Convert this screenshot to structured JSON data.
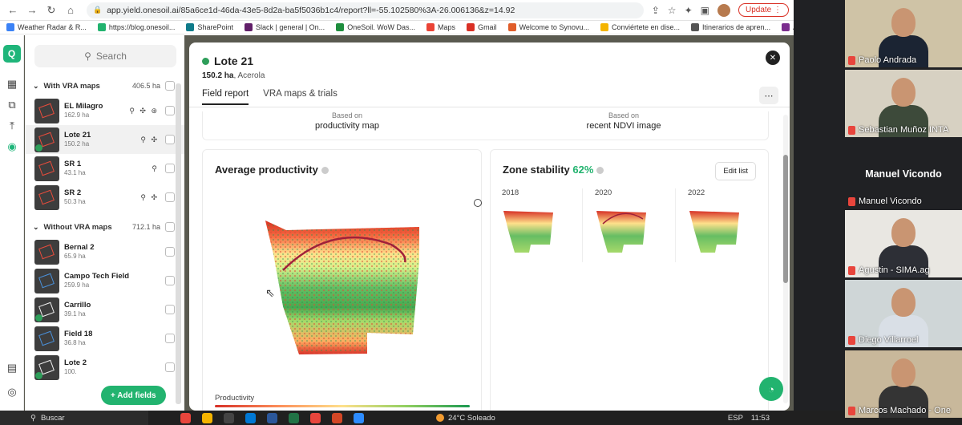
{
  "browser": {
    "url": "app.yield.onesoil.ai/85a6ce1d-46da-43e5-8d2a-ba5f5036b1c4/report?ll=-55.102580%3A-26.006136&z=14.92",
    "update_label": "Update",
    "bookmarks": [
      {
        "label": "Weather Radar & R...",
        "color": "#3b82f6"
      },
      {
        "label": "https://blog.onesoil...",
        "color": "#22b36f"
      },
      {
        "label": "SharePoint",
        "color": "#0f7b8a"
      },
      {
        "label": "Slack | general | On...",
        "color": "#611f69"
      },
      {
        "label": "OneSoil. WoW Das...",
        "color": "#1e8e3e"
      },
      {
        "label": "Maps",
        "color": "#ea4335"
      },
      {
        "label": "Gmail",
        "color": "#d93025"
      },
      {
        "label": "Welcome to Synovu...",
        "color": "#e05d2a"
      },
      {
        "label": "Conviértete en dise...",
        "color": "#f4b400"
      },
      {
        "label": "Itinerarios de apren...",
        "color": "#555555"
      },
      {
        "label": "Attend networking...",
        "color": "#7b2d8e"
      }
    ]
  },
  "sidebar": {
    "search_placeholder": "Search",
    "with_vra": {
      "label": "With VRA maps",
      "area": "406.5 ha"
    },
    "with_vra_fields": [
      {
        "name": "EL Milagro",
        "area": "162.9 ha",
        "icons": "⚲ ✣ ⊛",
        "color": "red",
        "badge": false
      },
      {
        "name": "Lote 21",
        "area": "150.2 ha",
        "icons": "⚲ ✣",
        "color": "red",
        "badge": true
      },
      {
        "name": "SR 1",
        "area": "43.1 ha",
        "icons": "⚲",
        "color": "red",
        "badge": false
      },
      {
        "name": "SR 2",
        "area": "50.3 ha",
        "icons": "⚲ ✣",
        "color": "red",
        "badge": false
      }
    ],
    "without_vra": {
      "label": "Without VRA maps",
      "area": "712.1 ha"
    },
    "without_vra_fields": [
      {
        "name": "Bernal 2",
        "area": "65.9 ha",
        "color": "red",
        "badge": false
      },
      {
        "name": "Campo Tech Field",
        "area": "259.9 ha",
        "color": "blue",
        "badge": false
      },
      {
        "name": "Carrillo",
        "area": "39.1 ha",
        "color": "white",
        "badge": true
      },
      {
        "name": "Field 18",
        "area": "36.8 ha",
        "color": "blue",
        "badge": false
      },
      {
        "name": "Lote 2",
        "area": "100.",
        "color": "white",
        "badge": true
      }
    ],
    "add_fields_label": "+ Add fields"
  },
  "modal": {
    "title": "Lote 21",
    "area": "150.2 ha",
    "crop": "Acerola",
    "tabs": [
      "Field report",
      "VRA maps & trials"
    ],
    "based_left": {
      "small": "Based on",
      "big": "productivity map"
    },
    "based_right": {
      "small": "Based on",
      "big": "recent NDVI image"
    },
    "avg_productivity_title": "Average productivity",
    "zone_stability_title": "Zone stability",
    "zone_stability_pct": "62%",
    "edit_list_label": "Edit list",
    "years": [
      "2018",
      "2020",
      "2022"
    ],
    "productivity_label": "Productivity"
  },
  "taskbar": {
    "search_label": "Buscar",
    "weather": "24°C Soleado",
    "lang": "ESP",
    "time": "11:53"
  },
  "call": {
    "participants": [
      {
        "name": "Paolo Andrada",
        "bg": "#cfc3a6",
        "shirt": "#1b2433"
      },
      {
        "name": "Sebastian Muñoz INTA",
        "bg": "#d7d1c2",
        "shirt": "#3d4a3a"
      },
      {
        "name": "Manuel Vicondo",
        "bg": "#202124",
        "shirt": ""
      },
      {
        "name": "Agustin - SIMA.ag",
        "bg": "#e9e7e2",
        "shirt": "#2d2f36"
      },
      {
        "name": "Diego Villarroel",
        "bg": "#cfd6d7",
        "shirt": "#d9dfe6"
      },
      {
        "name": "Marcos Machado - One",
        "bg": "#c8b89b",
        "shirt": "#343434"
      }
    ]
  }
}
